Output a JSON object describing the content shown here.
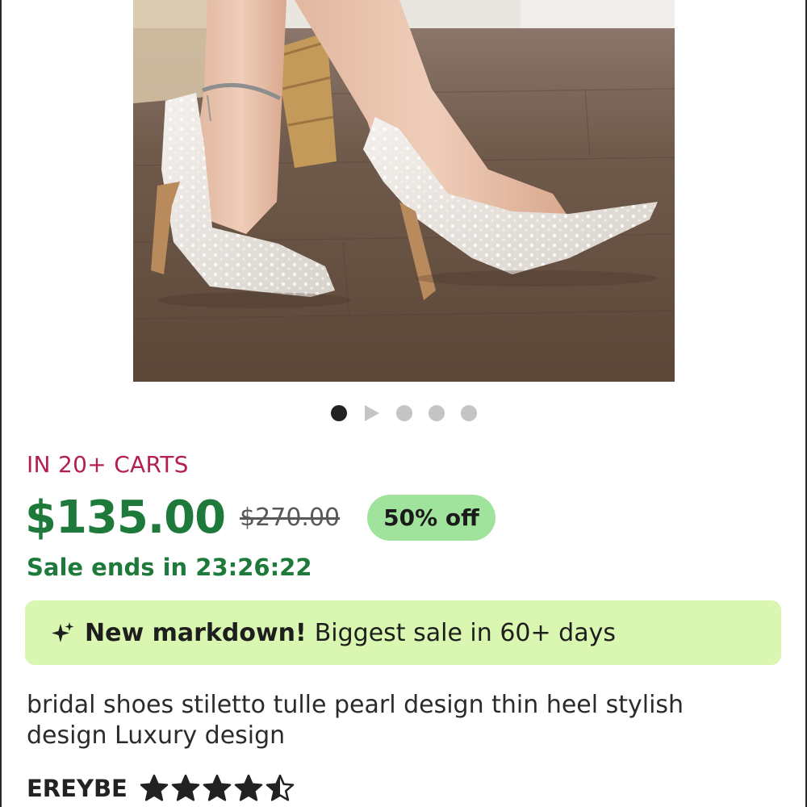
{
  "product_image": {
    "name": "bridal-shoes-photo",
    "slide_index": 1,
    "slide_count": 5,
    "video_slide_index": 2
  },
  "listing": {
    "carts_badge": "IN 20+ CARTS",
    "price": "$135.00",
    "original_price": "$270.00",
    "discount": "50% off",
    "sale_ends": "Sale ends in 23:26:22"
  },
  "banner": {
    "icon": "sparkle-icon",
    "strong": "New markdown!",
    "text": "Biggest sale in 60+ days"
  },
  "title": "bridal shoes stiletto tulle pearl design thin heel stylish design Luxury design",
  "seller": {
    "name": "EREYBE",
    "rating": 4.5,
    "rating_max": 5
  },
  "colors": {
    "price_green": "#1d7a3a",
    "carts_red": "#b51f4f",
    "discount_bg": "#9fe39c",
    "banner_bg": "#d9f7b0"
  }
}
